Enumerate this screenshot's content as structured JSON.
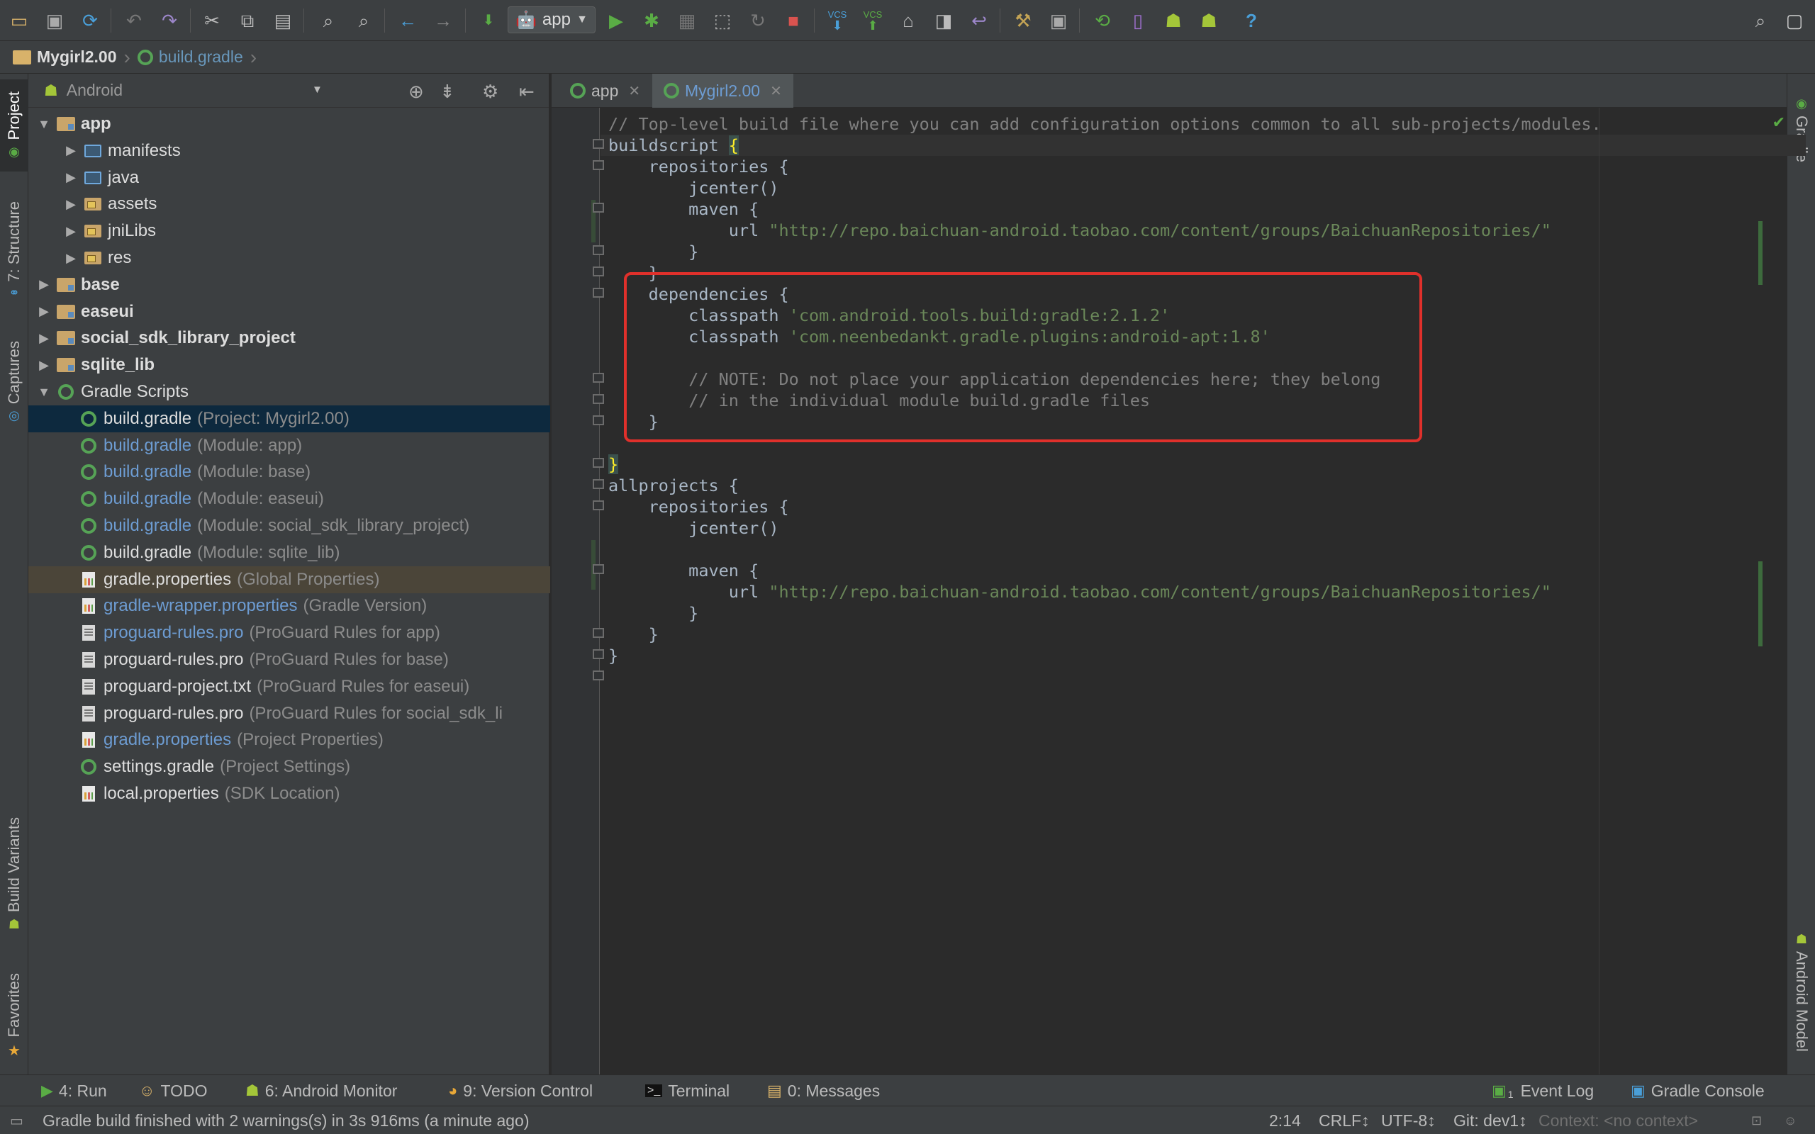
{
  "toolbar": {
    "run_config": "app",
    "icons": [
      "open-icon",
      "save-icon",
      "sync-icon",
      "undo-icon",
      "redo-icon",
      "cut-icon",
      "copy-icon",
      "paste-icon",
      "find-icon",
      "replace-icon",
      "back-icon",
      "forward-icon",
      "make-icon",
      "run-icon",
      "debug-icon",
      "coverage-icon",
      "attach-debugger-icon",
      "rerun-icon",
      "stop-icon",
      "vcs-update-icon",
      "vcs-commit-icon",
      "vcs-history-icon",
      "vcs-compare-icon",
      "vcs-revert-icon",
      "project-structure-icon",
      "sdk-manager-icon",
      "sync-gradle-icon",
      "avd-manager-icon",
      "android-device-monitor-icon",
      "android-icon",
      "help-icon",
      "search-everywhere-icon",
      "user-icon"
    ],
    "vcs_label": "VCS",
    "help": "?"
  },
  "breadcrumb": {
    "project": "Mygirl2.00",
    "file": "build.gradle"
  },
  "left_strip": {
    "tabs": [
      "Project",
      "7: Structure",
      "Captures",
      "Build Variants",
      "Favorites"
    ]
  },
  "right_strip": {
    "tabs": [
      "Gradle",
      "Android Model"
    ]
  },
  "project_panel": {
    "view_mode": "Android",
    "tree": [
      {
        "name": "app",
        "desc": "",
        "expanded": true
      },
      {
        "name": "manifests",
        "desc": ""
      },
      {
        "name": "java",
        "desc": ""
      },
      {
        "name": "assets",
        "desc": ""
      },
      {
        "name": "jniLibs",
        "desc": ""
      },
      {
        "name": "res",
        "desc": ""
      },
      {
        "name": "base",
        "desc": ""
      },
      {
        "name": "easeui",
        "desc": ""
      },
      {
        "name": "social_sdk_library_project",
        "desc": ""
      },
      {
        "name": "sqlite_lib",
        "desc": ""
      },
      {
        "name": "Gradle Scripts",
        "desc": "",
        "expanded": true
      },
      {
        "name": "build.gradle",
        "desc": "(Project: Mygirl2.00)",
        "selected": true
      },
      {
        "name": "build.gradle",
        "desc": "(Module: app)"
      },
      {
        "name": "build.gradle",
        "desc": "(Module: base)"
      },
      {
        "name": "build.gradle",
        "desc": "(Module: easeui)"
      },
      {
        "name": "build.gradle",
        "desc": "(Module: social_sdk_library_project)"
      },
      {
        "name": "build.gradle",
        "desc": "(Module: sqlite_lib)"
      },
      {
        "name": "gradle.properties",
        "desc": "(Global Properties)"
      },
      {
        "name": "gradle-wrapper.properties",
        "desc": "(Gradle Version)"
      },
      {
        "name": "proguard-rules.pro",
        "desc": "(ProGuard Rules for app)"
      },
      {
        "name": "proguard-rules.pro",
        "desc": "(ProGuard Rules for base)"
      },
      {
        "name": "proguard-project.txt",
        "desc": "(ProGuard Rules for easeui)"
      },
      {
        "name": "proguard-rules.pro",
        "desc": "(ProGuard Rules for social_sdk_li"
      },
      {
        "name": "gradle.properties",
        "desc": "(Project Properties)"
      },
      {
        "name": "settings.gradle",
        "desc": "(Project Settings)"
      },
      {
        "name": "local.properties",
        "desc": "(SDK Location)"
      }
    ]
  },
  "editor": {
    "tabs": [
      {
        "label": "app",
        "active": false
      },
      {
        "label": "Mygirl2.00",
        "active": true
      }
    ],
    "caret_position": "2:14"
  },
  "bottom_tools": {
    "run": "4: Run",
    "todo": "TODO",
    "android_monitor": "6: Android Monitor",
    "version_control": "9: Version Control",
    "terminal": "Terminal",
    "messages": "0: Messages",
    "event_log": "Event Log",
    "event_log_count": "1",
    "gradle_console": "Gradle Console"
  },
  "status_bar": {
    "message": "Gradle build finished with 2 warnings(s) in 3s 916ms (a minute ago)",
    "position": "2:14",
    "line_separator": "CRLF↕",
    "encoding": "UTF-8↕",
    "git_branch": "Git: dev1↕",
    "context": "Context: <no context>"
  }
}
